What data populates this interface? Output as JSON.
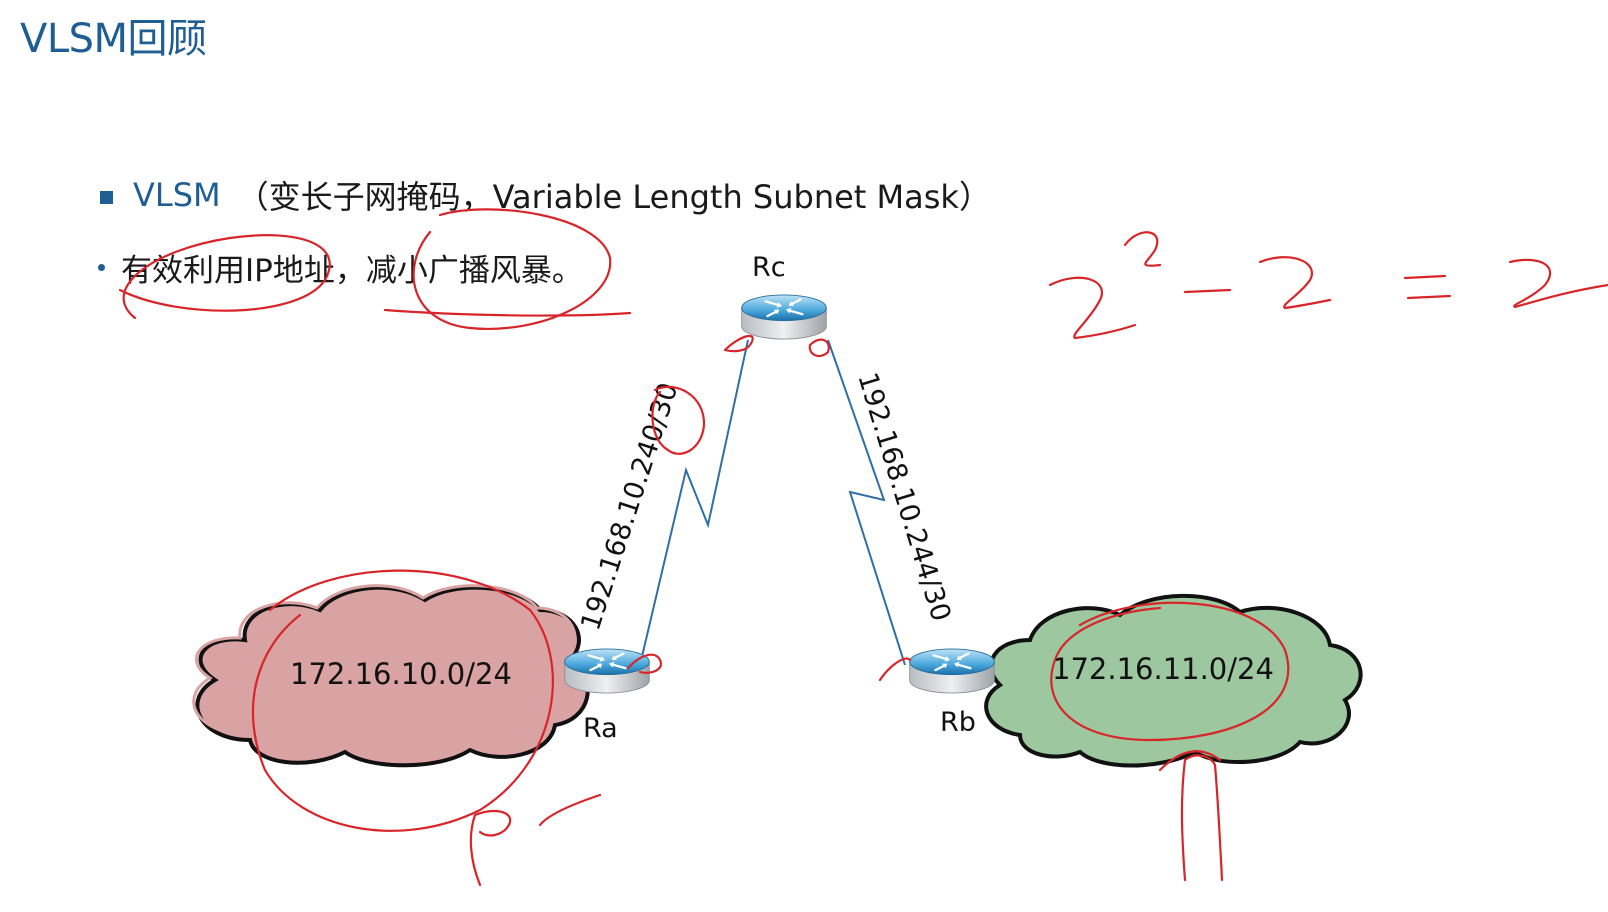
{
  "slide": {
    "title": "VLSM回顾",
    "bullet1_key": "VLSM",
    "bullet1_desc": "（变长子网掩码，Variable Length Subnet Mask）",
    "bullet2_text": "有效利用IP地址，减小广播风暴。"
  },
  "diagram": {
    "routers": {
      "ra": "Ra",
      "rb": "Rb",
      "rc": "Rc"
    },
    "networks": {
      "left": "172.16.10.0/24",
      "right": "172.16.11.0/24"
    },
    "links": {
      "ra_rc": "192.168.10.240/30",
      "rc_rb": "192.168.10.244/30"
    },
    "colors": {
      "left_cloud": "#d9a3a3",
      "right_cloud": "#9cc79f",
      "link_line": "#2f6fa6",
      "annotation_ink": "#d8252a",
      "title_blue": "#1f5e93"
    }
  },
  "annotations": {
    "icons": [
      "hand-drawn-ellipse",
      "hand-drawn-equation",
      "hand-drawn-arrow",
      "hand-drawn-pc"
    ]
  }
}
